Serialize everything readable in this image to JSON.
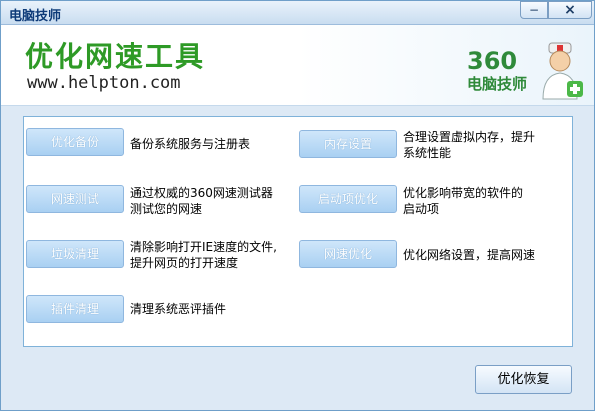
{
  "window": {
    "title": "电脑技师",
    "minimize_glyph": "−",
    "close_glyph": "×"
  },
  "header": {
    "title": "优化网速工具",
    "url": "www.helpton.com",
    "brand_number": "360",
    "brand_text": "电脑技师"
  },
  "tools": [
    {
      "button": "优化备份",
      "desc_line1": "备份系统服务与注册表",
      "desc_line2": ""
    },
    {
      "button": "网速测试",
      "desc_line1": "通过权威的360网速测试器",
      "desc_line2": "测试您的网速"
    },
    {
      "button": "垃圾清理",
      "desc_line1": "清除影响打开IE速度的文件,",
      "desc_line2": "提升网页的打开速度"
    },
    {
      "button": "插件清理",
      "desc_line1": "清理系统恶评插件",
      "desc_line2": ""
    },
    {
      "button": "内存设置",
      "desc_line1": "合理设置虚拟内存，提升",
      "desc_line2": "系统性能"
    },
    {
      "button": "启动项优化",
      "desc_line1": "优化影响带宽的软件的",
      "desc_line2": "启动项"
    },
    {
      "button": "网速优化",
      "desc_line1": "优化网络设置，提高网速",
      "desc_line2": ""
    }
  ],
  "footer": {
    "restore_label": "优化恢复"
  }
}
